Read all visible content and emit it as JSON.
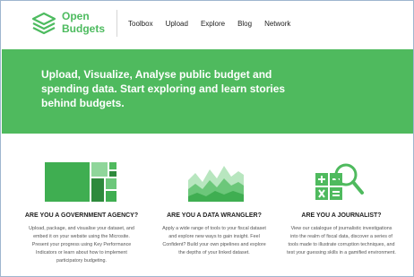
{
  "brand": {
    "name_line1": "Open",
    "name_line2": "Budgets"
  },
  "nav": {
    "items": [
      "Toolbox",
      "Upload",
      "Explore",
      "Blog",
      "Network"
    ]
  },
  "hero": {
    "headline": "Upload, Visualize, Analyse public budget and spending data. Start exploring and learn stories behind budgets."
  },
  "features": [
    {
      "title": "ARE YOU A GOVERNMENT AGENCY?",
      "body": "Upload, package, and visualise your dataset, and embed it on your website using the Microsite. Present your progress using Key Performance Indicators or learn about how to implement participatory budgeting.",
      "icon": "treemap-icon"
    },
    {
      "title": "ARE YOU A DATA WRANGLER?",
      "body": "Apply a wide range of tools to your fiscal dataset and explore new ways to gain insight. Feel Confident? Build your own pipelines and explore the depths of your linked dataset.",
      "icon": "area-chart-icon"
    },
    {
      "title": "ARE YOU A JOURNALIST?",
      "body": "View our catalogue of journalistic investigations into the realm of fiscal data, discover a series of tools made to illustrate corruption techniques, and test your guessing skills in a gamified environment.",
      "icon": "calculator-magnifier-icon"
    }
  ],
  "colors": {
    "brand_green": "#4fba5e",
    "dark_green": "#2e8a3c",
    "light_green": "#8fd69a"
  }
}
